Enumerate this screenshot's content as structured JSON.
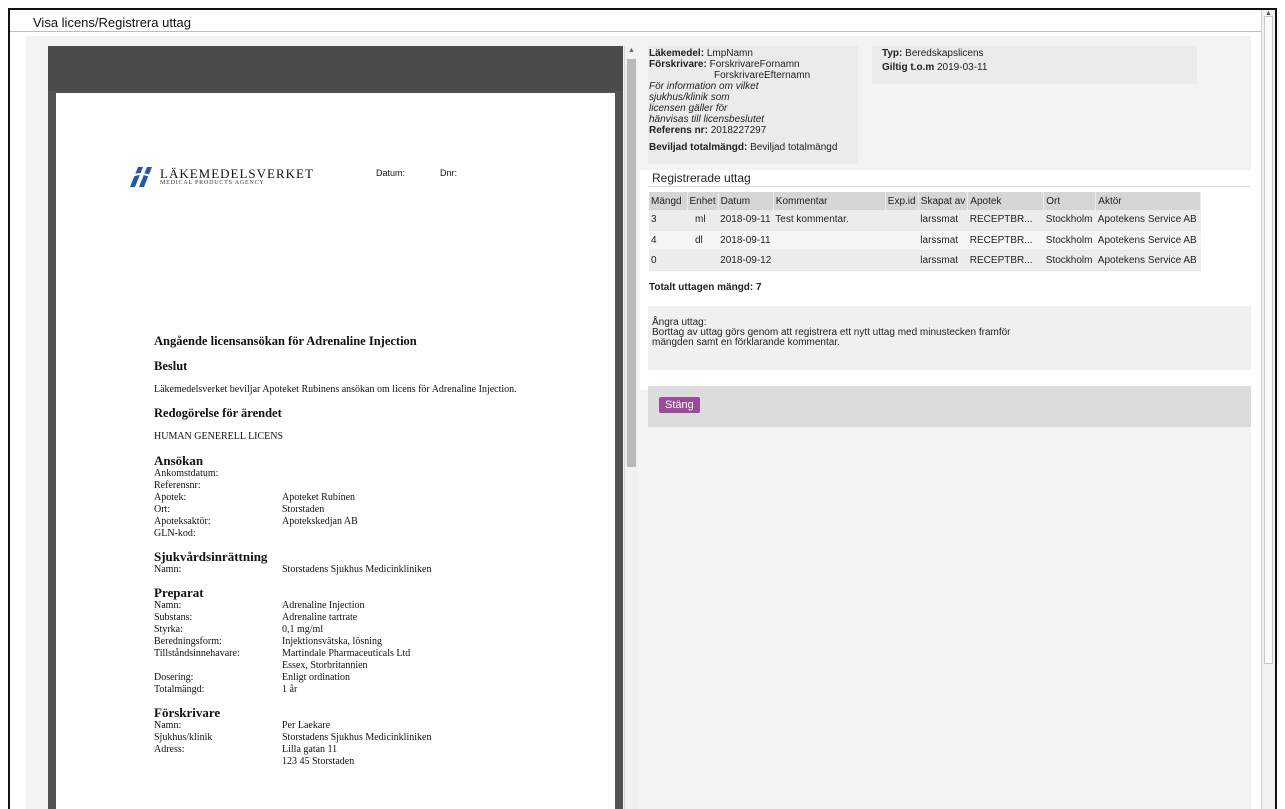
{
  "window": {
    "title": "Visa licens/Registrera uttag"
  },
  "pdf": {
    "logo_name": "LÄKEMEDELSVERKET",
    "logo_sub": "MEDICAL PRODUCTS AGENCY",
    "datum_label": "Datum:",
    "dnr_label": "Dnr:",
    "heading": "Angående licensansökan för Adrenaline Injection",
    "beslut_title": "Beslut",
    "beslut_text": "Läkemedelsverket beviljar Apoteket Rubinens ansökan om licens för Adrenaline Injection.",
    "redogorelse_title": "Redogörelse för ärendet",
    "redogorelse_text": "HUMAN GENERELL LICENS",
    "ansokan": {
      "title": "Ansökan",
      "rows": [
        {
          "k": "Ankomstdatum:",
          "v": ""
        },
        {
          "k": "Referensnr:",
          "v": ""
        },
        {
          "k": "Apotek:",
          "v": "Apoteket Rubinen"
        },
        {
          "k": "Ort:",
          "v": "Storstaden"
        },
        {
          "k": "Apoteksaktör:",
          "v": "Apotekskedjan AB"
        },
        {
          "k": "GLN-kod:",
          "v": ""
        }
      ]
    },
    "sjukvard": {
      "title": "Sjukvårdsinrättning",
      "rows": [
        {
          "k": "Namn:",
          "v": "Storstadens Sjukhus Medicinkliniken"
        }
      ]
    },
    "preparat": {
      "title": "Preparat",
      "rows": [
        {
          "k": "Namn:",
          "v": "Adrenaline Injection"
        },
        {
          "k": "Substans:",
          "v": "Adrenaline tartrate"
        },
        {
          "k": "Styrka:",
          "v": "0,1 mg/ml"
        },
        {
          "k": "Beredningsform:",
          "v": "Injektionsvätska, lösning"
        },
        {
          "k": "Tillståndsinnehavare:",
          "v": "Martindale Pharmaceuticals Ltd"
        },
        {
          "k": "",
          "v": "Essex, Storbritannien"
        },
        {
          "k": "Dosering:",
          "v": "Enligt ordination"
        },
        {
          "k": "Totalmängd:",
          "v": "1 år"
        }
      ]
    },
    "forskrivare": {
      "title": "Förskrivare",
      "rows": [
        {
          "k": "Namn:",
          "v": "Per Laekare"
        },
        {
          "k": "Sjukhus/klinik",
          "v": "Storstadens Sjukhus Medicinkliniken"
        },
        {
          "k": "Adress:",
          "v": "Lilla gatan 11"
        },
        {
          "k": "",
          "v": "123 45 Storstaden"
        }
      ]
    }
  },
  "info": {
    "lakemedel_label": "Läkemedel:",
    "lakemedel_value": "LmpNamn",
    "forskrivare_label": "Förskrivare:",
    "forskrivare_first": "ForskrivareFornamn",
    "forskrivare_last": "ForskrivareEfternamn",
    "note_1": "För information om vilket",
    "note_2": "sjukhus/klinik som",
    "note_3": "licensen gäller för",
    "note_4": "hänvisas till licensbeslutet",
    "referens_label": "Referens nr:",
    "referens_value": "2018227297",
    "beviljad_label": "Beviljad totalmängd:",
    "beviljad_value": "Beviljad totalmängd",
    "typ_label": "Typ:",
    "typ_value": "Beredskapslicens",
    "giltig_label": "Giltig t.o.m",
    "giltig_value": "2019-03-11"
  },
  "uttag": {
    "title": "Registrerade uttag",
    "columns": [
      "Mängd",
      "Enhet",
      "Datum",
      "Kommentar",
      "Exp.id",
      "Skapat av",
      "Apotek",
      "Ort",
      "Aktör"
    ],
    "rows": [
      [
        "3",
        "ml",
        "2018-09-11",
        "Test kommentar.",
        "",
        "larssmat",
        "RECEPTBR...",
        "Stockholm",
        "Apotekens Service AB"
      ],
      [
        "4",
        "dl",
        "2018-09-11",
        "",
        "",
        "larssmat",
        "RECEPTBR...",
        "Stockholm",
        "Apotekens Service AB"
      ],
      [
        "0",
        "",
        "2018-09-12",
        "",
        "",
        "larssmat",
        "RECEPTBR...",
        "Stockholm",
        "Apotekens Service AB"
      ]
    ],
    "total_text": "Totalt uttagen mängd: 7"
  },
  "undo": {
    "title": "Ångra uttag:",
    "line_1": "Borttag av uttag görs genom att registrera ett nytt uttag med minustecken framför",
    "line_2": "mängden samt en förklarande kommentar."
  },
  "actions": {
    "close_label": "Stäng"
  },
  "colors": {
    "accent": "#9a4a96",
    "logo_blue": "#1f5aa6"
  }
}
